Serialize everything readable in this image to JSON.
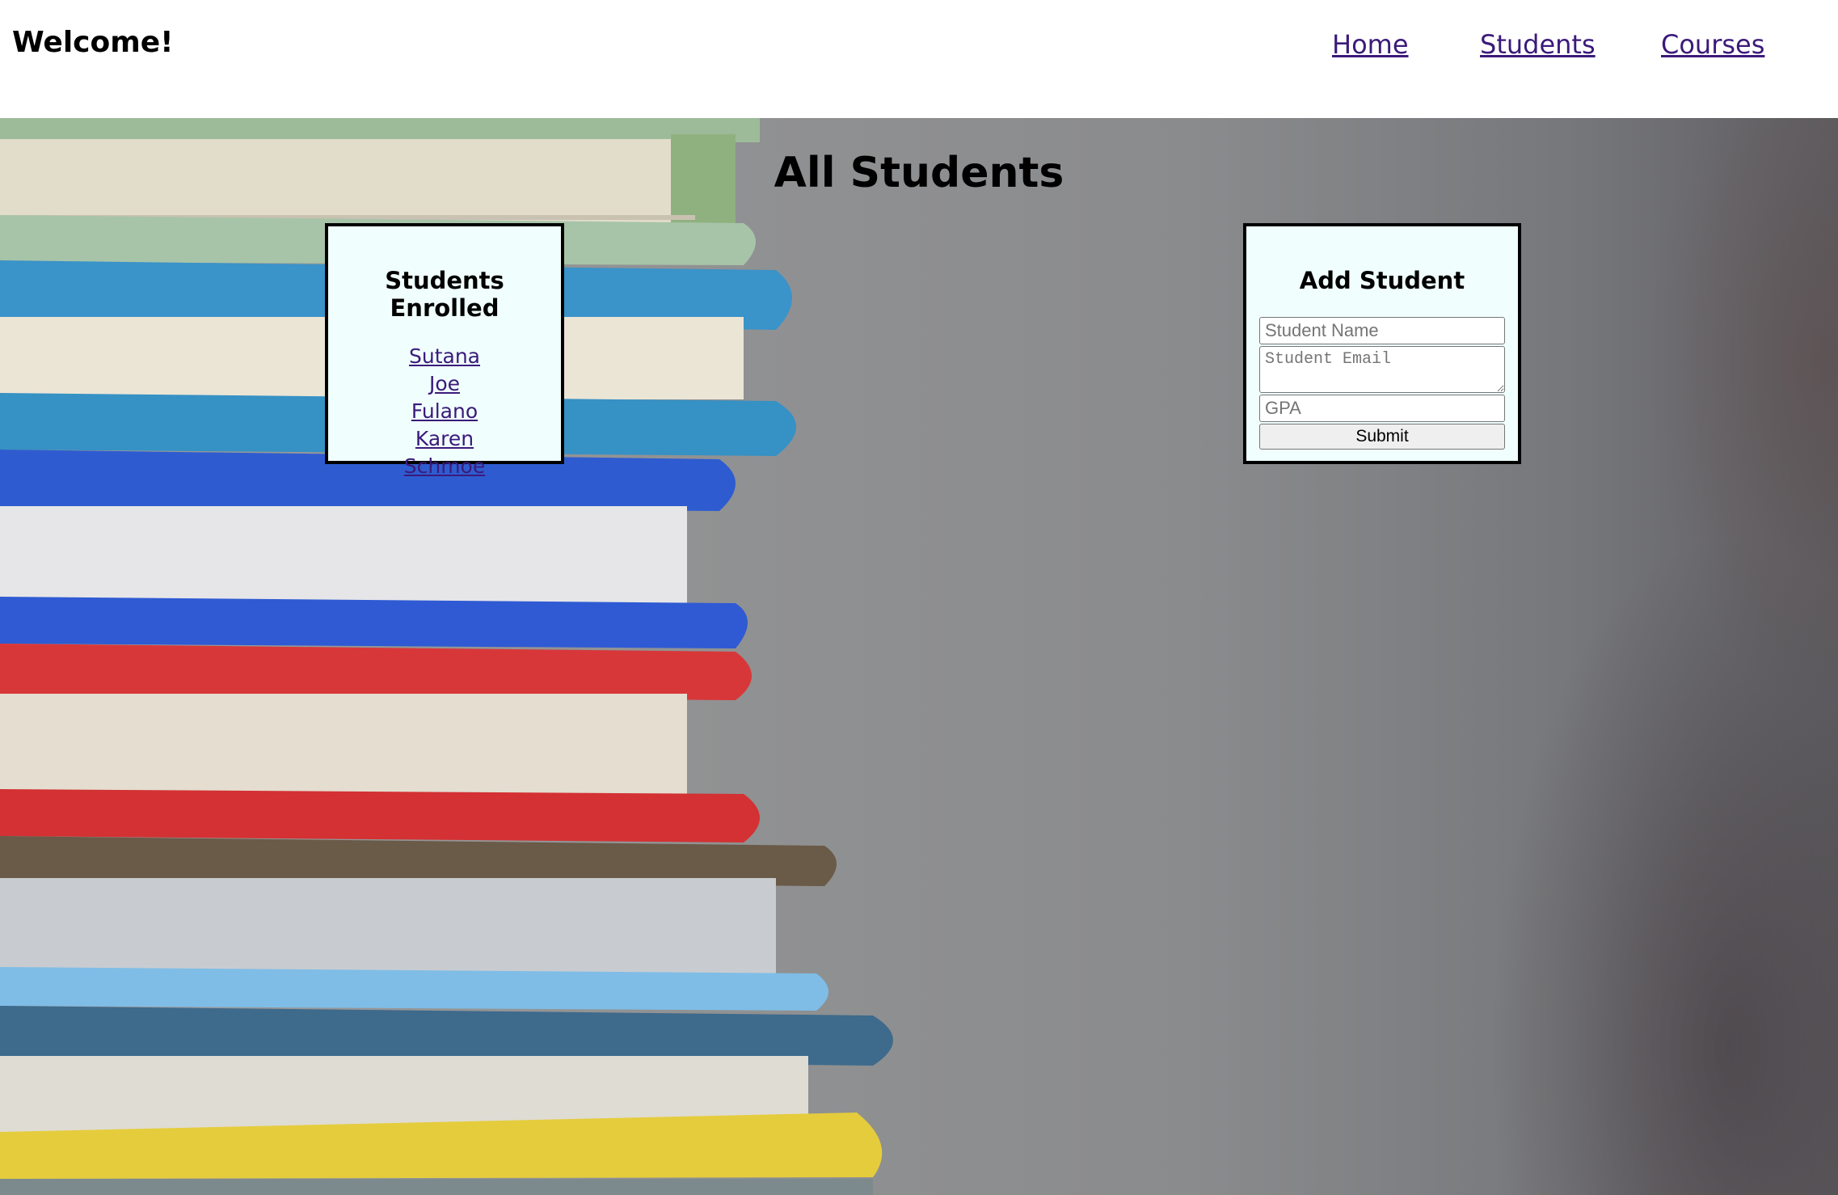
{
  "header": {
    "brand": "Welcome!",
    "nav": [
      {
        "label": "Home"
      },
      {
        "label": "Students"
      },
      {
        "label": "Courses"
      }
    ]
  },
  "main": {
    "title": "All Students",
    "enrolled": {
      "title": "Students Enrolled",
      "students": [
        "Sutana",
        "Joe",
        "Fulano",
        "Karen",
        "Schmoe"
      ]
    },
    "add_student": {
      "title": "Add Student",
      "name_placeholder": "Student Name",
      "email_placeholder": "Student Email",
      "gpa_placeholder": "GPA",
      "submit_label": "Submit"
    }
  },
  "colors": {
    "link": "#3b1a7a",
    "card_background": "#f0fffd",
    "card_border": "#000000"
  }
}
